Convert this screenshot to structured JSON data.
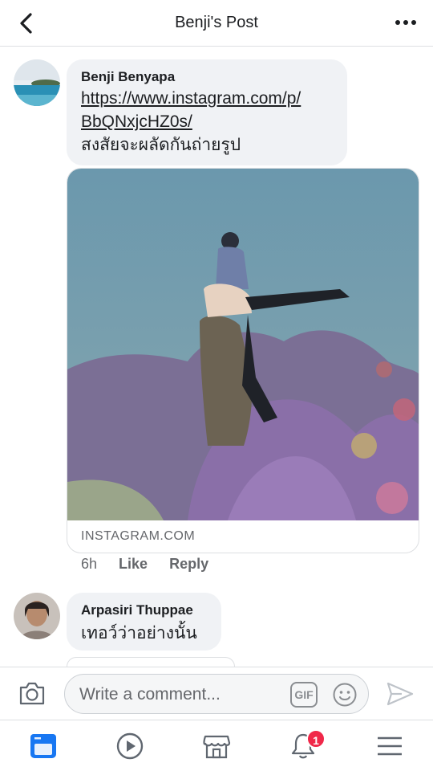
{
  "header": {
    "title": "Benji's Post"
  },
  "comments": [
    {
      "author": "Benji Benyapa",
      "link_line1": "https://www.instagram.com/p/",
      "link_line2": "BbQNxjcHZ0s/",
      "text": "สงสัยจะผลัดกันถ่ายรูป",
      "preview_domain": "INSTAGRAM.COM",
      "time": "6h",
      "like_label": "Like",
      "reply_label": "Reply"
    },
    {
      "author": "Arpasiri Thuppae",
      "text": "เทอว์ว่าอย่างนั้น"
    }
  ],
  "composer": {
    "placeholder": "Write a comment...",
    "gif_label": "GIF"
  },
  "nav": {
    "notification_count": "1"
  },
  "colors": {
    "bubble": "#f0f2f5",
    "badge": "#f02849",
    "active_tab": "#1877f2"
  }
}
